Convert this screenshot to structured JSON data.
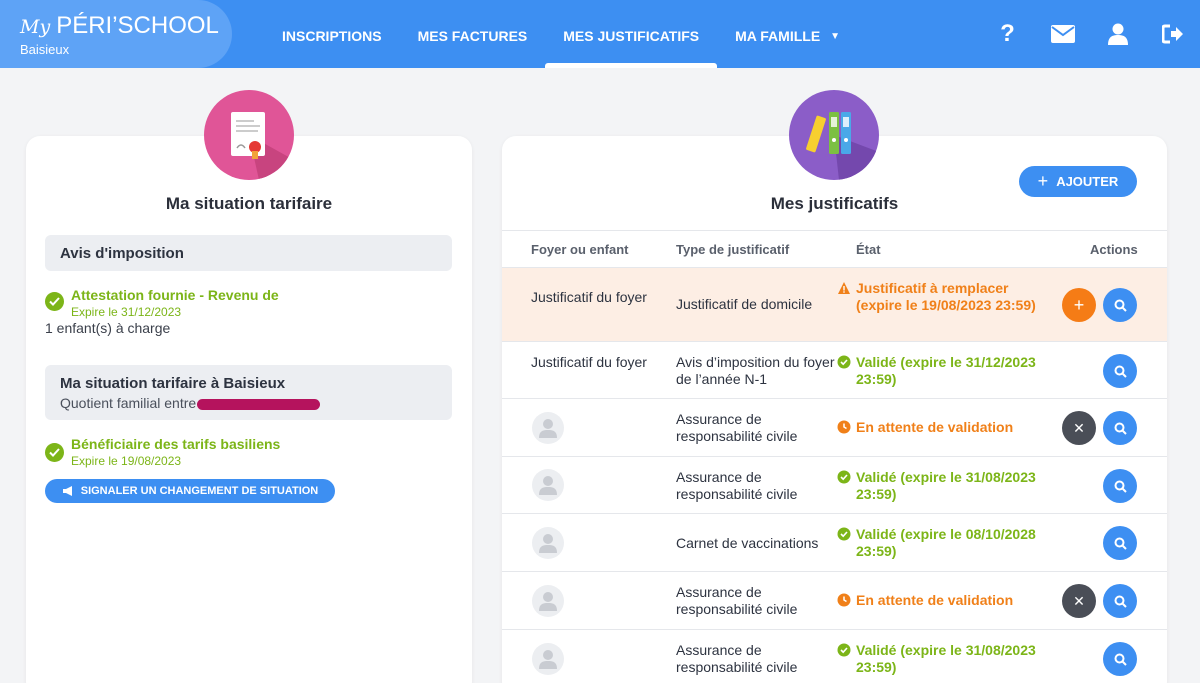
{
  "brand": {
    "prefix": "My",
    "name": "PÉRI’SCHOOL",
    "city": "Baisieux"
  },
  "nav": {
    "items": [
      {
        "label": "INSCRIPTIONS"
      },
      {
        "label": "MES FACTURES"
      },
      {
        "label": "MES JUSTIFICATIFS",
        "active": true
      },
      {
        "label": "MA FAMILLE"
      }
    ]
  },
  "header_icons": {
    "help": "?",
    "mail": "envelope-icon",
    "user": "user-icon",
    "logout": "logout-icon"
  },
  "left_card": {
    "title": "Ma situation tarifaire",
    "section1": {
      "title": "Avis d'imposition",
      "status": "Attestation fournie - Revenu de",
      "expire": "Expire le 31/12/2023",
      "note": "1 enfant(s) à charge"
    },
    "section2": {
      "title": "Ma situation tarifaire à Baisieux",
      "sub": "Quotient familial entre",
      "status": "Bénéficiaire des tarifs basiliens",
      "expire": "Expire le 19/08/2023",
      "button": "SIGNALER UN CHANGEMENT DE SITUATION"
    }
  },
  "right_card": {
    "title": "Mes justificatifs",
    "add_button": "AJOUTER",
    "columns": {
      "holder": "Foyer ou enfant",
      "type": "Type de justificatif",
      "state": "État",
      "actions": "Actions"
    },
    "rows": [
      {
        "holder": "Justificatif du foyer",
        "type": "Justificatif de domicile",
        "state": "Justificatif à remplacer (expire le 19/08/2023 23:59)"
      },
      {
        "holder": "Justificatif du foyer",
        "type": "Avis d’imposition du foyer de l’année N-1",
        "state": "Validé (expire le 31/12/2023 23:59)"
      },
      {
        "holder": "",
        "type": "Assurance de responsabilité civile",
        "state": "En attente de validation"
      },
      {
        "holder": "",
        "type": "Assurance de responsabilité civile",
        "state": "Validé (expire le 31/08/2023 23:59)"
      },
      {
        "holder": "",
        "type": "Carnet de vaccinations",
        "state": "Validé (expire le 08/10/2028 23:59)"
      },
      {
        "holder": "",
        "type": "Assurance de responsabilité civile",
        "state": "En attente de validation"
      },
      {
        "holder": "",
        "type": "Assurance de responsabilité civile",
        "state": "Validé (expire le 31/08/2023 23:59)"
      }
    ]
  },
  "colors": {
    "header": "#3d8ff2",
    "valid": "#7cb518",
    "warning": "#f08019",
    "highlight_row": "#fdeee4",
    "redacted": "#b5135d"
  }
}
